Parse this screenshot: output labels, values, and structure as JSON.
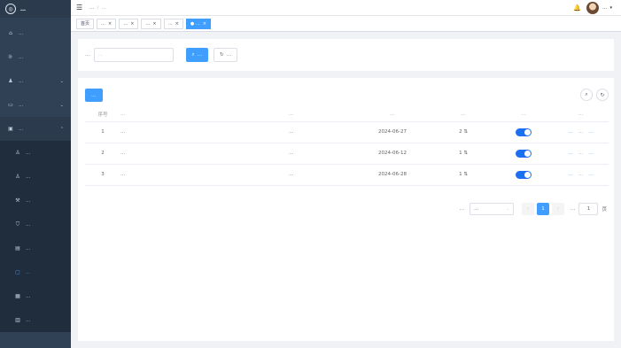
{
  "brand": {
    "title": "…"
  },
  "sidebar": {
    "items": [
      {
        "label": "…",
        "icon": "home-icon"
      },
      {
        "label": "…",
        "icon": "chart-icon"
      },
      {
        "label": "…",
        "icon": "user-icon"
      },
      {
        "label": "…",
        "icon": "monitor-icon"
      },
      {
        "label": "…",
        "icon": "book-icon"
      }
    ],
    "subitems": [
      {
        "label": "…",
        "icon": "person-icon"
      },
      {
        "label": "…",
        "icon": "user-icon"
      },
      {
        "label": "…",
        "icon": "tool-icon"
      },
      {
        "label": "…",
        "icon": "shield-icon"
      },
      {
        "label": "…",
        "icon": "doc-icon"
      },
      {
        "label": "…",
        "icon": "document-icon"
      },
      {
        "label": "…",
        "icon": "file-icon"
      },
      {
        "label": "…",
        "icon": "book-icon"
      }
    ]
  },
  "header": {
    "breadcrumb": [
      "…",
      "…"
    ],
    "user_name": "…"
  },
  "tags": [
    {
      "label": "首页"
    },
    {
      "label": "…"
    },
    {
      "label": "…"
    },
    {
      "label": "…"
    },
    {
      "label": "…"
    },
    {
      "label": "…"
    }
  ],
  "search": {
    "label": "…",
    "placeholder": "…",
    "search_btn": "…",
    "reset_btn": "…"
  },
  "table": {
    "add_btn": "…",
    "headers": [
      "序号",
      "…",
      "…",
      "…",
      "…",
      "…",
      "…"
    ],
    "rows": [
      {
        "no": "1",
        "title": "…",
        "creator": "…",
        "date": "2024-06-27",
        "count": "2",
        "actions": [
          "…",
          "…",
          "…"
        ]
      },
      {
        "no": "2",
        "title": "…",
        "creator": "…",
        "date": "2024-06-12",
        "count": "1",
        "actions": [
          "…",
          "…",
          "…"
        ]
      },
      {
        "no": "3",
        "title": "…",
        "creator": "…",
        "date": "2024-06-28",
        "count": "1",
        "actions": [
          "…",
          "…",
          "…"
        ]
      }
    ]
  },
  "pager": {
    "total": "…",
    "page_size": "…",
    "current": "1",
    "goto_label": "…",
    "goto_value": "1",
    "page_unit": "页"
  },
  "colors": {
    "primary": "#409eff",
    "sidebar_bg": "#304156"
  }
}
